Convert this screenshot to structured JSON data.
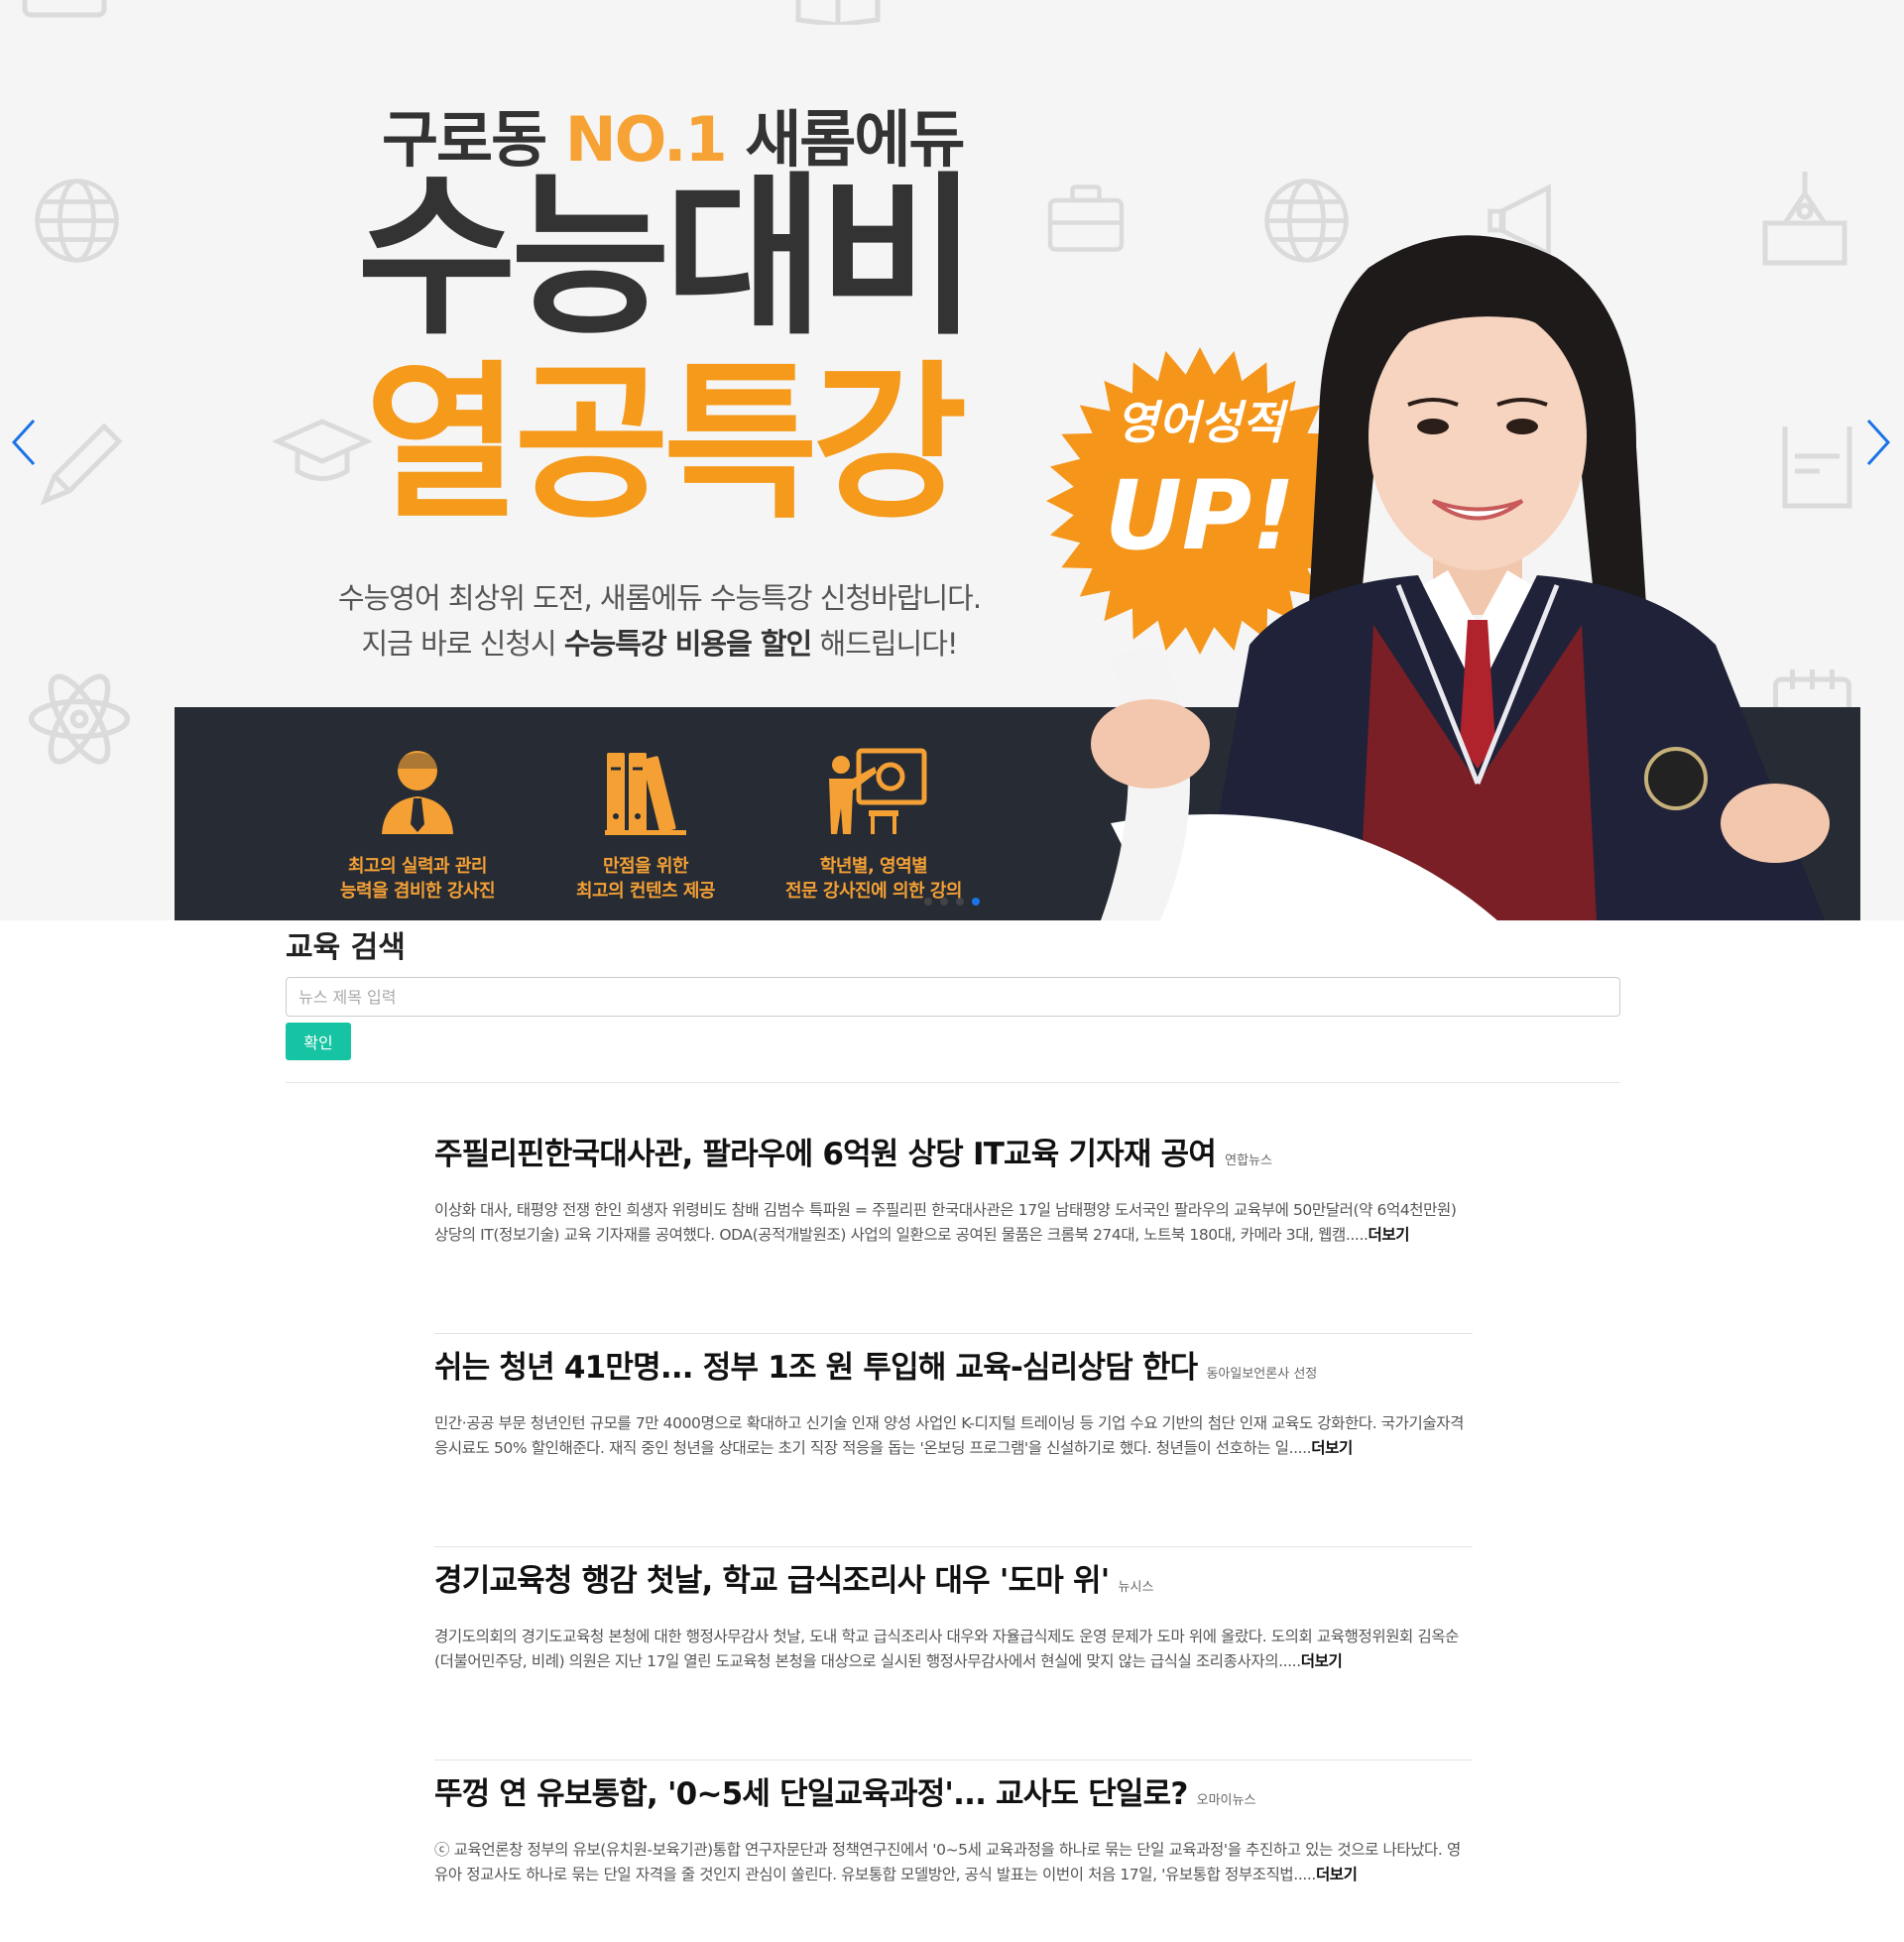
{
  "hero": {
    "tagline_prefix": "구로동",
    "tagline_accent": "NO.1",
    "tagline_suffix": "새롬에듀",
    "title_line1": "수능대비",
    "title_line2": "열공특강",
    "desc_line1": "수능영어 최상위 도전, 새롬에듀 수능특강 신청바랍니다.",
    "desc_line2_prefix": "지금 바로 신청시",
    "desc_line2_bold": "수능특강 비용을 할인",
    "desc_line2_suffix": "해드립니다!",
    "badge_line1": "영어성적",
    "badge_line2": "UP!",
    "features": [
      {
        "line1": "최고의 실력과 관리",
        "line2": "능력을 겸비한 강사진",
        "icon": "teacher-icon"
      },
      {
        "line1": "만점을 위한",
        "line2": "최고의 컨텐츠 제공",
        "icon": "books-icon"
      },
      {
        "line1": "학년별, 영역별",
        "line2": "전문 강사진에 의한 강의",
        "icon": "lecture-icon"
      }
    ],
    "slide_count": 4,
    "active_slide": 4,
    "colors": {
      "accent": "#f59a1b",
      "bar": "#272b33",
      "arrow": "#1a73e8"
    }
  },
  "search": {
    "title": "교육 검색",
    "placeholder": "뉴스 제목 입력",
    "button_label": "확인",
    "button_color": "#16c3a3"
  },
  "news": [
    {
      "title": "주필리핀한국대사관, 팔라우에 6억원 상당 IT교육 기자재 공여",
      "source": "연합뉴스",
      "body": "이상화 대사, 태평양 전쟁 한인 희생자 위령비도 참배 김범수 특파원 = 주필리핀 한국대사관은 17일 남태평양 도서국인 팔라우의 교육부에 50만달러(약 6억4천만원) 상당의 IT(정보기술) 교육 기자재를 공여했다. ODA(공적개발원조) 사업의 일환으로 공여된 물품은 크롬북 274대, 노트북 180대, 카메라 3대, 웹캠.....",
      "more": "더보기"
    },
    {
      "title": "쉬는 청년 41만명... 정부 1조 원 투입해 교육-심리상담 한다",
      "source": "동아일보언론사 선정",
      "body": "민간·공공 부문 청년인턴 규모를 7만 4000명으로 확대하고 신기술 인재 양성 사업인 K-디지털 트레이닝 등 기업 수요 기반의 첨단 인재 교육도 강화한다. 국가기술자격 응시료도 50% 할인해준다. 재직 중인 청년을 상대로는 초기 직장 적응을 돕는 '온보딩 프로그램'을 신설하기로 했다. 청년들이 선호하는 일.....",
      "more": "더보기"
    },
    {
      "title": "경기교육청 행감 첫날, 학교 급식조리사 대우 '도마 위'",
      "source": "뉴시스",
      "body": "경기도의회의 경기도교육청 본청에 대한 행정사무감사 첫날, 도내 학교 급식조리사 대우와 자율급식제도 운영 문제가 도마 위에 올랐다. 도의회 교육행정위원회 김옥순(더불어민주당, 비례) 의원은 지난 17일 열린 도교육청 본청을 대상으로 실시된 행정사무감사에서 현실에 맞지 않는 급식실 조리종사자의.....",
      "more": "더보기"
    },
    {
      "title": "뚜껑 연 유보통합, '0~5세 단일교육과정'... 교사도 단일로?",
      "source": "오마이뉴스",
      "body": "ⓒ 교육언론창 정부의 유보(유치원-보육기관)통합 연구자문단과 정책연구진에서 '0~5세 교육과정을 하나로 묶는 단일 교육과정'을 추진하고 있는 것으로 나타났다. 영유아 정교사도 하나로 묶는 단일 자격을 줄 것인지 관심이 쏠린다. 유보통합 모델방안, 공식 발표는 이번이 처음 17일, '유보통합 정부조직법.....",
      "more": "더보기"
    }
  ]
}
